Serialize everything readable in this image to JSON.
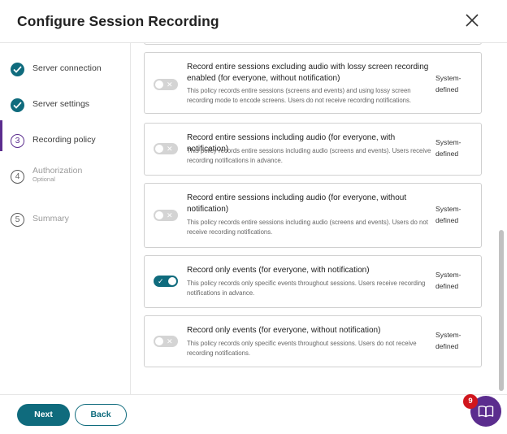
{
  "header": {
    "title": "Configure Session Recording"
  },
  "steps": [
    {
      "label": "Server connection",
      "state": "done"
    },
    {
      "label": "Server settings",
      "state": "done"
    },
    {
      "label": "Recording policy",
      "state": "current",
      "number": "3"
    },
    {
      "label": "Authorization",
      "sub": "Optional",
      "state": "pending",
      "number": "4"
    },
    {
      "label": "Summary",
      "state": "pending",
      "number": "5"
    }
  ],
  "policies": [
    {
      "title": "Record entire sessions excluding audio with lossy screen recording enabled (for everyone, without notification)",
      "description": "This policy records entire sessions (screens and events) and using lossy screen recording mode to encode screens. Users do not receive recording notifications.",
      "type": "System-defined",
      "enabled": false
    },
    {
      "title": "Record entire sessions including audio (for everyone, with notification)",
      "description": "This policy records entire sessions including audio (screens and events). Users receive recording notifications in advance.",
      "type": "System-defined",
      "enabled": false
    },
    {
      "title": "Record entire sessions including audio (for everyone, without notification)",
      "description": "This policy records entire sessions including audio (screens and events). Users do not receive recording notifications.",
      "type": "System-defined",
      "enabled": false
    },
    {
      "title": "Record only events (for everyone, with notification)",
      "description": "This policy records only specific events throughout sessions. Users receive recording notifications in advance.",
      "type": "System-defined",
      "enabled": true
    },
    {
      "title": "Record only events (for everyone, without notification)",
      "description": "This policy records only specific events throughout sessions. Users do not receive recording notifications.",
      "type": "System-defined",
      "enabled": false
    }
  ],
  "footer": {
    "next_label": "Next",
    "back_label": "Back"
  },
  "help": {
    "badge_count": "9",
    "icon": "help-book-icon"
  },
  "icons": {
    "close": "close-icon",
    "toggle_on": "check-icon",
    "toggle_off": "x-icon",
    "done": "check-icon"
  },
  "colors": {
    "accent": "#0f6b7d",
    "current_step": "#5b2d8e",
    "badge": "#d0161d"
  }
}
